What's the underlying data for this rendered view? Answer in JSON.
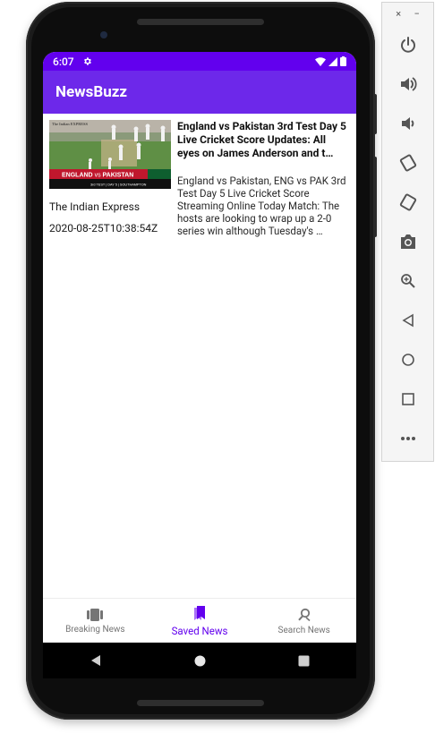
{
  "status_bar": {
    "time": "6:07"
  },
  "app_bar": {
    "title": "NewsBuzz"
  },
  "article": {
    "title": "England vs Pakistan 3rd Test Day 5 Live Cricket Score Updates: All eyes on James Anderson and t…",
    "description": "England vs Pakistan, ENG vs PAK 3rd Test Day 5 Live Cricket Score Streaming Online Today Match: The hosts are looking to wrap up a 2-0 series win although Tuesday's …",
    "source": "The Indian Express",
    "published_at": "2020-08-25T10:38:54Z",
    "thumbnail": {
      "masthead": "The Indian EXPRESS",
      "banner_left": "ENGLAND",
      "banner_vs": "vs",
      "banner_right": "PAKISTAN",
      "subline": "3rd TEST | DAY 5 | SOUTHAMPTON"
    }
  },
  "bottom_nav": {
    "items": [
      {
        "label": "Breaking News",
        "icon": "breaking-news-icon",
        "active": false
      },
      {
        "label": "Saved News",
        "icon": "bookmark-icon",
        "active": true
      },
      {
        "label": "Search News",
        "icon": "search-icon",
        "active": false
      }
    ]
  },
  "emulator_toolbar": {
    "buttons": [
      "close-icon",
      "minimize-icon",
      "power-icon",
      "volume-up-icon",
      "volume-down-icon",
      "rotate-left-icon",
      "rotate-right-icon",
      "camera-icon",
      "zoom-icon",
      "back-icon",
      "home-icon",
      "overview-icon",
      "more-icon"
    ],
    "close_glyph": "×",
    "minimize_glyph": "−"
  },
  "colors": {
    "primary": "#6200ee",
    "app_bar": "#6d28ea",
    "active_nav": "#6200ee"
  }
}
